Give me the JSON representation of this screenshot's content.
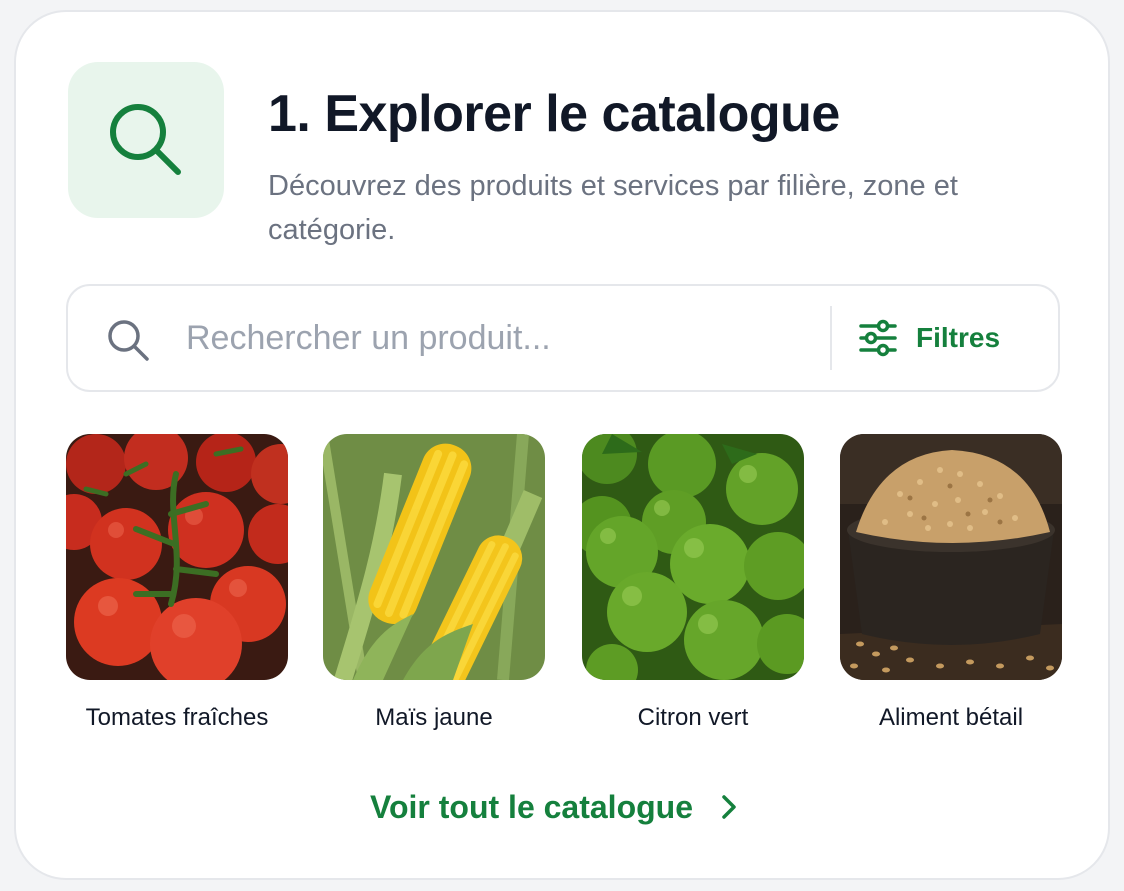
{
  "header": {
    "title": "1. Explorer le catalogue",
    "subtitle": "Découvrez des produits et services par filière, zone et catégorie.",
    "icon": "search-icon"
  },
  "search": {
    "placeholder": "Rechercher un produit...",
    "value": "",
    "filters_label": "Filtres",
    "filters_icon": "sliders-icon"
  },
  "products": [
    {
      "label": "Tomates fraîches",
      "image": "tomatoes-image"
    },
    {
      "label": "Maïs jaune",
      "image": "corn-image"
    },
    {
      "label": "Citron vert",
      "image": "limes-image"
    },
    {
      "label": "Aliment bétail",
      "image": "livestock-feed-image"
    }
  ],
  "footer": {
    "see_all_label": "Voir tout le catalogue",
    "icon": "chevron-right-icon"
  },
  "colors": {
    "accent": "#15803d",
    "icon_tile_bg": "#e8f5ec",
    "title": "#111827",
    "muted": "#6b7280"
  }
}
